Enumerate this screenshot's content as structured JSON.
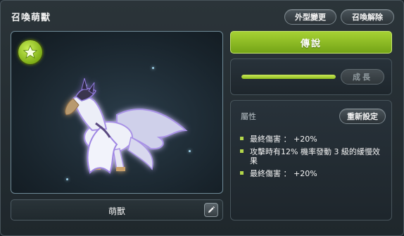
{
  "window": {
    "title": "召喚萌獸",
    "buttons": {
      "appearance_change": "外型變更",
      "summon_release": "召喚解除"
    }
  },
  "preview": {
    "badge_icon": "star-icon",
    "pet_name": "萌獸",
    "edit_icon": "pencil-icon"
  },
  "rank": {
    "label": "傳說"
  },
  "growth": {
    "button_label": "成長",
    "progress": 1.0
  },
  "attributes": {
    "title": "屬性",
    "reset_label": "重新設定",
    "items": [
      "最終傷害 ： +20%",
      "攻擊時有12% 機率發動 3 級的緩慢效果",
      "最終傷害 ： +20%"
    ]
  },
  "colors": {
    "accent_green": "#9bc82b",
    "panel_bg": "#222b31"
  }
}
